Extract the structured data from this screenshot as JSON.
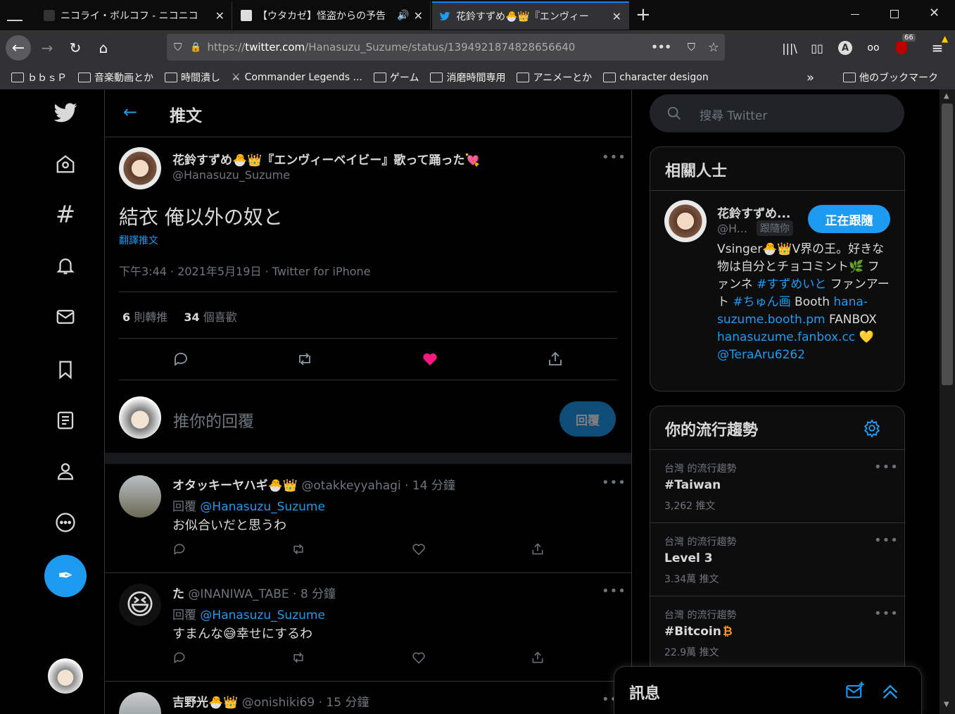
{
  "browser": {
    "tabs": [
      {
        "title": "ニコライ・ボルコフ - ニコニコ"
      },
      {
        "title": "【ウタカゼ】怪盗からの予告"
      },
      {
        "title": "花鈴すずめ🐣👑『エンヴィー"
      }
    ],
    "url_prefix": "https://",
    "url_domain": "twitter.com",
    "url_path": "/Hanasuzu_Suzume/status/1394921874828656640",
    "ext_badge": "66",
    "bookmarks": [
      "ｂｂｓＰ",
      "音楽動画とか",
      "時間潰し",
      "Commander Legends ...",
      "ゲーム",
      "消磨時間専用",
      "アニメーとか",
      "character desigon"
    ],
    "other_bookmarks": "他のブックマーク"
  },
  "header": {
    "title": "推文"
  },
  "tweet": {
    "name": "花鈴すずめ🐣👑『エンヴィーベイビー』歌って踊った💘",
    "handle": "@Hanasuzu_Suzume",
    "text": "結衣 俺以外の奴と",
    "translate": "翻譯推文",
    "meta": "下午3:44 · 2021年5月19日 · Twitter for iPhone",
    "retweets_num": "6",
    "retweets_label": "則轉推",
    "likes_num": "34",
    "likes_label": "個喜歡"
  },
  "reply_box": {
    "placeholder": "推你的回覆",
    "button": "回覆"
  },
  "replies": [
    {
      "name": "オタッキーヤハギ🐣👑",
      "meta": "@otakkeyyahagi · 14 分鐘",
      "reply_to_prefix": "回覆",
      "reply_to": "@Hanasuzu_Suzume",
      "text": "お似合いだと思うわ"
    },
    {
      "name": "た",
      "meta": "@INANIWA_TABE · 8 分鐘",
      "reply_to_prefix": "回覆",
      "reply_to": "@Hanasuzu_Suzume",
      "text": "すまんな😅幸せにするわ"
    },
    {
      "name": "吉野光🐣👑",
      "meta": "@onishiki69 · 15 分鐘",
      "reply_to_prefix": "",
      "reply_to": "",
      "text": ""
    }
  ],
  "search": {
    "placeholder": "搜尋 Twitter"
  },
  "related": {
    "title": "相關人士",
    "name": "花鈴すずめ...",
    "handle": "@H...",
    "follows_you": "跟隨你",
    "follow_btn": "正在跟隨",
    "bio_1": "Vsinger🐣👑V界の王。好きな物は自分とチョコミント🌿 ファンネ ",
    "bio_tag1": "#すずめいと",
    "bio_2": " ファンアート ",
    "bio_tag2": "#ちゅん画",
    "bio_3": " Booth ",
    "bio_link1": "hana-suzume.booth.pm",
    "bio_4": " FANBOX ",
    "bio_link2": "hanasuzume.fanbox.cc",
    "bio_5": " 💛 ",
    "bio_link3": "@TeraAru6262"
  },
  "trends": {
    "title": "你的流行趨勢",
    "items": [
      {
        "context": "台灣 的流行趨勢",
        "name": "#Taiwan",
        "count": "3,262 推文"
      },
      {
        "context": "台灣 的流行趨勢",
        "name": "Level 3",
        "count": "3.34萬 推文"
      },
      {
        "context": "台灣 的流行趨勢",
        "name": "#Bitcoin",
        "count": "22.9萬 推文"
      }
    ]
  },
  "messages": {
    "title": "訊息"
  },
  "colors": {
    "accent": "#1d9bf0",
    "like": "#f91880"
  }
}
